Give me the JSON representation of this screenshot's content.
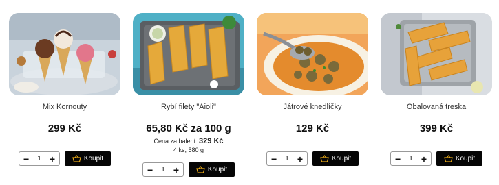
{
  "products": [
    {
      "name": "Mix Kornouty",
      "price": "299 Kč",
      "qty": "1",
      "buy_label": "Koupit",
      "image_icon": "ice-cream-cones-image"
    },
    {
      "name": "Rybí filety \"Aioli\"",
      "price": "65,80 Kč za 100 g",
      "pack_label": "Cena za balení:",
      "pack_price": "329 Kč",
      "pack_info": "4 ks, 580 g",
      "qty": "1",
      "buy_label": "Koupit",
      "image_icon": "breaded-fish-fillets-image"
    },
    {
      "name": "Játrové knedlíčky",
      "price": "129 Kč",
      "qty": "1",
      "buy_label": "Koupit",
      "image_icon": "liver-dumpling-soup-image"
    },
    {
      "name": "Obalovaná treska",
      "price": "399 Kč",
      "qty": "1",
      "buy_label": "Koupit",
      "image_icon": "breaded-cod-image"
    }
  ],
  "colors": {
    "button_bg": "#050505",
    "button_text": "#ffffff",
    "basket_icon": "#e6a817"
  },
  "icons": {
    "minus": "minus-icon",
    "plus": "plus-icon",
    "basket": "basket-icon"
  }
}
